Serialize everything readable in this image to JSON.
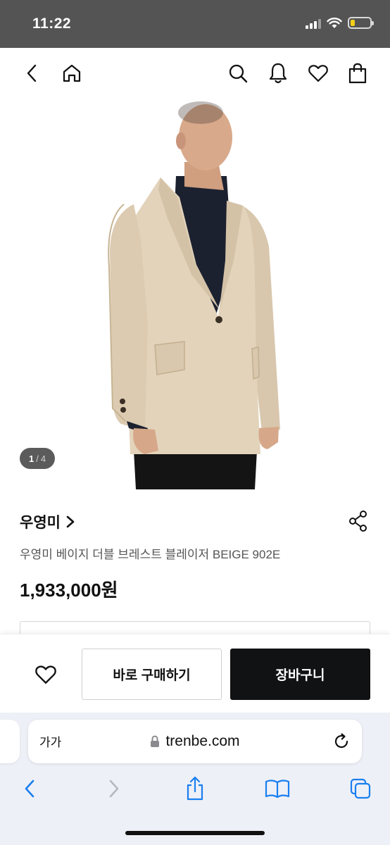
{
  "status_bar": {
    "time": "11:22"
  },
  "product": {
    "image_counter": {
      "current": "1",
      "separator": "/",
      "total": "4"
    },
    "brand": "우영미",
    "title": "우영미 베이지 더블 브레스트 블레이저 BEIGE 902E",
    "price": "1,933,000원"
  },
  "actions": {
    "buy_now_label": "바로 구매하기",
    "add_to_cart_label": "장바구니"
  },
  "browser": {
    "text_size_label": "가가",
    "url": "trenbe.com"
  },
  "icons": {
    "nav": [
      "back-icon",
      "home-icon",
      "search-icon",
      "bell-icon",
      "heart-icon",
      "shopping-bag-icon"
    ],
    "toolbar": [
      "back-arrow-icon",
      "forward-arrow-icon",
      "share-icon",
      "bookmarks-icon",
      "tabs-icon"
    ]
  },
  "colors": {
    "status_bar": "#545454",
    "cart_button": "#111214",
    "safari_accent": "#1a7ff0",
    "battery": "#f2cf1c",
    "blazer": "#e3d3bb"
  }
}
